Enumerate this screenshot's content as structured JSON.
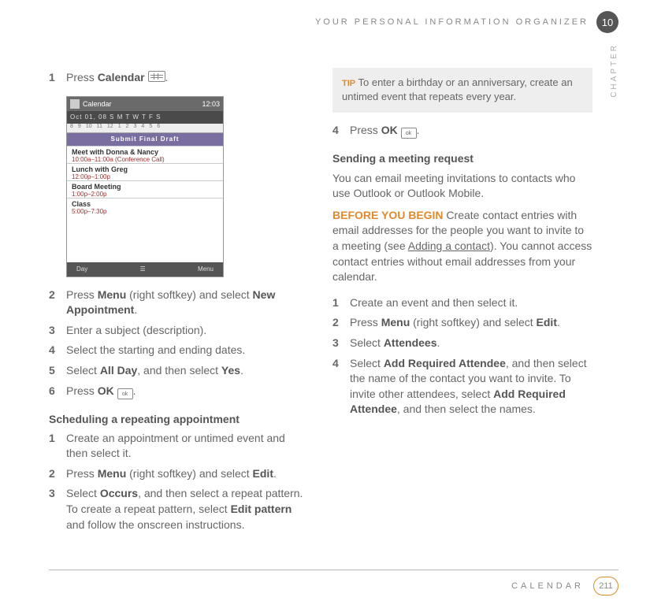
{
  "header": {
    "title": "YOUR PERSONAL INFORMATION ORGANIZER",
    "chapter_number": "10",
    "vertical_label": "CHAPTER"
  },
  "left": {
    "step1": {
      "num": "1",
      "pre": "Press ",
      "bold": "Calendar",
      "post": " ",
      "dot": "."
    },
    "screenshot": {
      "app": "Calendar",
      "clock": "12:03",
      "datebar": "Oct 01, 08   S M T W T F S",
      "hours": [
        "8",
        "9",
        "10",
        "11",
        "12",
        "1",
        "2",
        "3",
        "4",
        "5",
        "6"
      ],
      "band": "Submit Final Draft",
      "items": [
        {
          "title": "Meet with Donna & Nancy",
          "sub": "10:00a–11:00a (Conference Call)"
        },
        {
          "title": "Lunch with Greg",
          "sub": "12:00p–1:00p"
        },
        {
          "title": "Board Meeting",
          "sub": "1:00p–2:00p"
        },
        {
          "title": "Class",
          "sub": "5:00p–7:30p"
        }
      ],
      "soft_left": "Day",
      "soft_right": "Menu"
    },
    "step2": {
      "num": "2",
      "text_pre": "Press ",
      "b1": "Menu",
      "mid": " (right softkey) and select ",
      "b2": "New Appointment",
      "post": "."
    },
    "step3": {
      "num": "3",
      "text": "Enter a subject (description)."
    },
    "step4": {
      "num": "4",
      "text": "Select the starting and ending dates."
    },
    "step5": {
      "num": "5",
      "pre": "Select ",
      "b1": "All Day",
      "mid": ", and then select ",
      "b2": "Yes",
      "post": "."
    },
    "step6": {
      "num": "6",
      "pre": "Press ",
      "b1": "OK",
      "post": " ",
      "dot": "."
    },
    "heading_repeat": "Scheduling a repeating appointment",
    "rstep1": {
      "num": "1",
      "text": "Create an appointment or untimed event and then select it."
    },
    "rstep2": {
      "num": "2",
      "pre": "Press ",
      "b1": "Menu",
      "mid": " (right softkey) and select ",
      "b2": "Edit",
      "post": "."
    },
    "rstep3": {
      "num": "3",
      "pre": "Select ",
      "b1": "Occurs",
      "mid": ", and then select a repeat pattern. To create a repeat pattern, select ",
      "b2": "Edit pattern",
      "post": " and follow the onscreen instructions."
    }
  },
  "right": {
    "tip": {
      "label": "TIP",
      "text": " To enter a birthday or an anniversary, create an untimed event that repeats every year."
    },
    "step4top": {
      "num": "4",
      "pre": "Press ",
      "b1": "OK",
      "post": " ",
      "dot": "."
    },
    "heading_send": "Sending a meeting request",
    "para_intro": "You can email meeting invitations to contacts who use Outlook or Outlook Mobile.",
    "before": {
      "label": "BEFORE YOU BEGIN",
      "text": "  Create contact entries with email addresses for the people you want to invite to a meeting (see ",
      "link": "Adding a contact",
      "rest": "). You cannot access contact entries without email addresses from your calendar."
    },
    "mstep1": {
      "num": "1",
      "text": "Create an event and then select it."
    },
    "mstep2": {
      "num": "2",
      "pre": "Press ",
      "b1": "Menu",
      "mid": " (right softkey) and select ",
      "b2": "Edit",
      "post": "."
    },
    "mstep3": {
      "num": "3",
      "pre": "Select ",
      "b1": "Attendees",
      "post": "."
    },
    "mstep4": {
      "num": "4",
      "pre": "Select ",
      "b1": "Add Required Attendee",
      "mid": ", and then select the name of the contact you want to invite. To invite other attendees, select ",
      "b2": "Add Required Attendee",
      "post": ", and then select the names."
    }
  },
  "footer": {
    "title": "CALENDAR",
    "page": "211"
  }
}
